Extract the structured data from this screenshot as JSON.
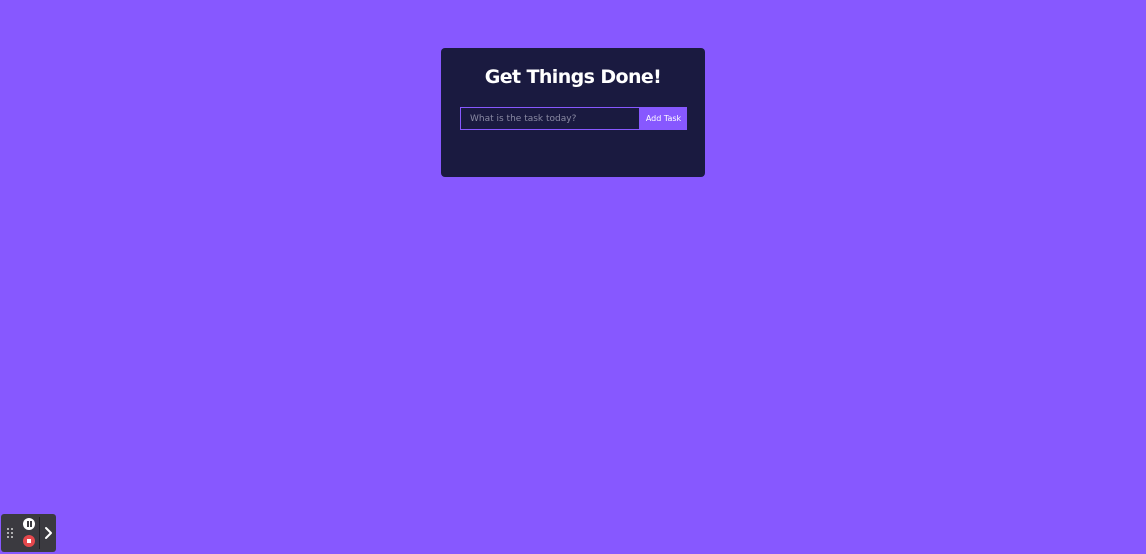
{
  "app": {
    "title": "Get Things Done!"
  },
  "form": {
    "input_placeholder": "What is the task today?",
    "input_value": "",
    "submit_label": "Add Task"
  },
  "recorder": {
    "icons": [
      "drag-handle-icon",
      "pause-icon",
      "stop-icon",
      "chevron-right-icon"
    ]
  },
  "colors": {
    "background": "#8758ff",
    "card": "#1a1a40",
    "accent": "#8758ff",
    "stop": "#e5484d"
  }
}
